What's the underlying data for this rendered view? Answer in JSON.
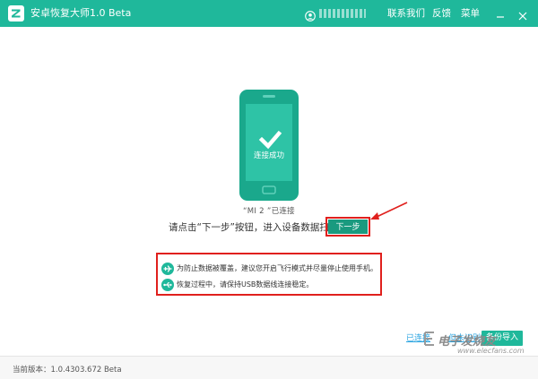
{
  "window": {
    "title": "安卓恢复大师1.0 Beta",
    "username": "",
    "menu": [
      "联系我们",
      "反馈",
      "菜单"
    ],
    "controls": [
      "minimize",
      "close"
    ],
    "accent_color": "#1fb89b",
    "highlight_color": "#e0201d"
  },
  "main": {
    "phone_label": "连接成功",
    "device_status": "“MI 2 ”已连接",
    "instruction": "请点击“下一步”按钮，进入设备数据扫描",
    "next_button": "下一步",
    "tips": [
      {
        "icon": "airplane-icon",
        "text": "为防止数据被覆盖，建议您开启飞行模式并尽量停止使用手机。"
      },
      {
        "icon": "usb-icon",
        "text": "恢复过程中，请保持USB数据线连接稳定。"
      }
    ]
  },
  "bottom": {
    "connected_link": "已连接",
    "not_recognized_link": "但未识别？",
    "backup_button": "备份导入",
    "watermark": "电子发烧友",
    "watermark_url": "www.elecfans.com"
  },
  "footer": {
    "version": "当前版本：1.0.4303.672 Beta"
  }
}
